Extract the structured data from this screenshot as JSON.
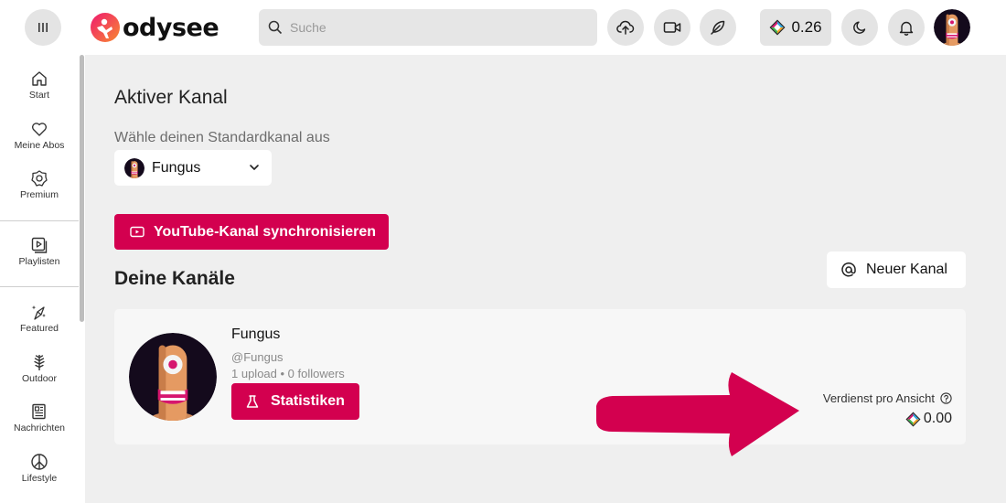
{
  "header": {
    "logo_text": "odysee",
    "search_placeholder": "Suche",
    "wallet_balance": "0.26"
  },
  "sidebar": {
    "items": [
      {
        "label": "Start",
        "icon": "home-icon"
      },
      {
        "label": "Meine Abos",
        "icon": "heart-icon"
      },
      {
        "label": "Premium",
        "icon": "premium-badge-icon"
      },
      {
        "label": "Playlisten",
        "icon": "playlist-icon"
      },
      {
        "label": "Featured",
        "icon": "featured-icon"
      },
      {
        "label": "Outdoor",
        "icon": "outdoor-icon"
      },
      {
        "label": "Nachrichten",
        "icon": "news-icon"
      },
      {
        "label": "Lifestyle",
        "icon": "lifestyle-icon"
      }
    ]
  },
  "main": {
    "active_channel_title": "Aktiver Kanal",
    "default_channel_label": "Wähle deinen Standardkanal aus",
    "selected_channel": "Fungus",
    "youtube_sync_label": "YouTube-Kanal synchronisieren",
    "your_channels_title": "Deine Kanäle",
    "new_channel_label": "Neuer Kanal"
  },
  "channel_card": {
    "name": "Fungus",
    "handle": "@Fungus",
    "stats": "1 upload • 0 followers",
    "statistics_label": "Statistiken",
    "earnings_label": "Verdienst pro Ansicht",
    "earnings_value": "0.00"
  },
  "colors": {
    "accent": "#d3004f",
    "arrow": "#d3004f",
    "background": "#efefef"
  }
}
